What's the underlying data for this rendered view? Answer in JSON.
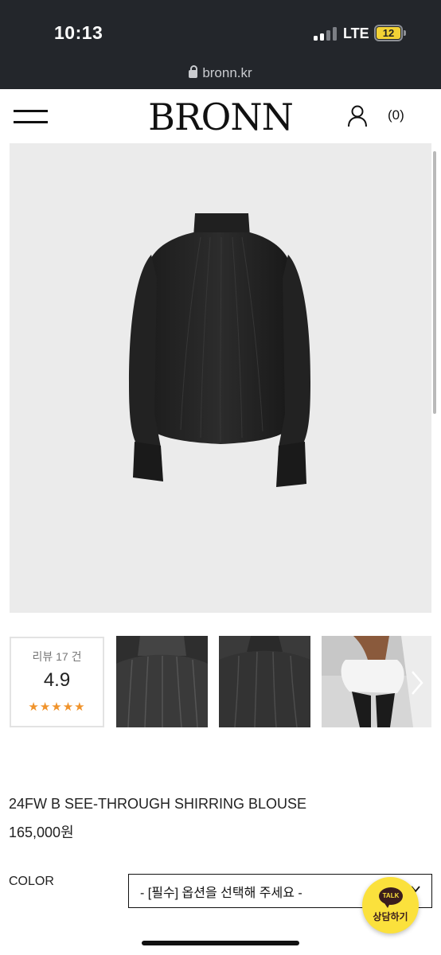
{
  "status_bar": {
    "time": "10:13",
    "network": "LTE",
    "battery": "12",
    "url": "bronn.kr"
  },
  "header": {
    "brand": "BRONN",
    "cart_count": "(0)",
    "icons": [
      "menu-icon",
      "user-icon"
    ]
  },
  "gallery": {
    "review_label": "리뷰 17 건",
    "rating": "4.9",
    "stars": "★★★★★",
    "thumbnails": [
      "thumbnail-1",
      "thumbnail-2",
      "thumbnail-3"
    ],
    "next_icon": "chevron-right-icon"
  },
  "product": {
    "name": "24FW B SEE-THROUGH SHIRRING BLOUSE",
    "price": "165,000원"
  },
  "options": {
    "color_label": "COLOR",
    "color_select_value": "- [필수] 옵션을 선택해 주세요 -"
  },
  "kakao": {
    "badge": "TALK",
    "label": "상담하기"
  },
  "colors": {
    "status_bar_bg": "#23262b",
    "star": "#f0932b",
    "kakao_yellow": "#fbe13c",
    "image_bg": "#ebebeb"
  }
}
